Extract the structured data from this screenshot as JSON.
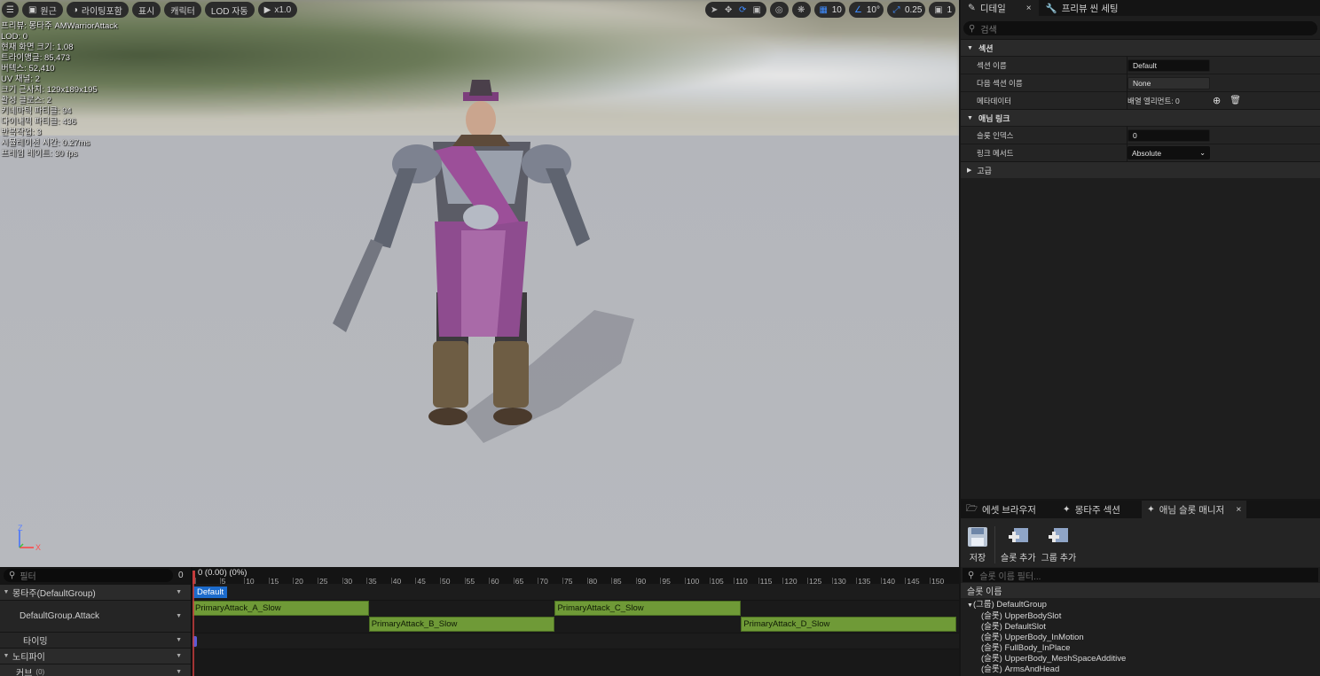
{
  "viewport": {
    "toolbar": {
      "menu_icon": "hamburger-icon",
      "perspective_label": "원근",
      "lighting_label": "라이팅포함",
      "show_label": "표시",
      "character_label": "캐릭터",
      "lod_label": "LOD 자동",
      "play_label": "x1.0",
      "grid_value": "10",
      "angle_value": "10°",
      "scale_value": "0.25",
      "camera_value": "1"
    },
    "stats": [
      "프리뷰: 몽타주 AMWarriorAttack",
      "LOD: 0",
      "현재 화면 크기: 1.08",
      "트라이앵글: 85,473",
      "버텍스: 52,410",
      "UV 채널: 2",
      "크기 근사치: 129x189x195",
      "활성 클로스: 2",
      "키네마틱 파티클: 94",
      "다이내믹 파티클: 436",
      "반복작업: 3",
      "시뮬레이션 시간: 0.27ms",
      "프레임 레이트: 30 fps"
    ],
    "axis": {
      "z": "Z",
      "x": "X"
    }
  },
  "details": {
    "tabs": [
      {
        "label": "디테일",
        "icon": "pencil-icon",
        "close": "×"
      },
      {
        "label": "프리뷰 씬 세팅",
        "icon": "wrench-icon"
      }
    ],
    "search_placeholder": "검색",
    "categories": {
      "section": "섹션",
      "anim_link": "애님 링크",
      "advanced": "고급"
    },
    "rows": {
      "section_name_label": "섹션 이름",
      "section_name_value": "Default",
      "next_section_label": "다음 섹션 이름",
      "next_section_value": "None",
      "metadata_label": "메타데이터",
      "metadata_value": "배열 엘리먼트: 0",
      "slot_index_label": "슬롯 인덱스",
      "slot_index_value": "0",
      "link_method_label": "링크 메서드",
      "link_method_value": "Absolute"
    }
  },
  "slot_manager": {
    "tabs": [
      {
        "label": "에셋 브라우저",
        "icon": "folder-icon"
      },
      {
        "label": "몽타주 섹션",
        "icon": "montage-icon"
      },
      {
        "label": "애님 슬롯 매니저",
        "icon": "slot-icon",
        "close": "×"
      }
    ],
    "toolbar": [
      {
        "label": "저장",
        "icon": "save-icon"
      },
      {
        "label": "슬롯 추가",
        "icon": "add-slot-icon"
      },
      {
        "label": "그룹 추가",
        "icon": "add-group-icon"
      }
    ],
    "search_placeholder": "슬롯 이름 필터...",
    "header": "슬롯 이름",
    "group": "(그룹) DefaultGroup",
    "slots": [
      "(슬롯) UpperBodySlot",
      "(슬롯) DefaultSlot",
      "(슬롯) UpperBody_InMotion",
      "(슬롯) FullBody_InPlace",
      "(슬롯) UpperBody_MeshSpaceAdditive",
      "(슬롯) ArmsAndHead"
    ]
  },
  "montage": {
    "filter_placeholder": "필터",
    "filter_count": "0",
    "tracks": {
      "montage_group": "몽타주(DefaultGroup)",
      "slot_track": "DefaultGroup.Attack",
      "timing": "타이밍",
      "notifies": "노티파이",
      "curves": "커브",
      "curves_count": "(0)"
    },
    "time_readout": "0 (0.00) (0%)",
    "ticks": [
      "0",
      "5",
      "10",
      "15",
      "20",
      "25",
      "30",
      "35",
      "40",
      "45",
      "50",
      "55",
      "60",
      "65",
      "70",
      "75",
      "80",
      "85",
      "90",
      "95",
      "100",
      "105",
      "110",
      "115",
      "120",
      "125",
      "130",
      "135",
      "140",
      "145",
      "150"
    ],
    "section_tag": "Default",
    "segments": [
      {
        "label": "PrimaryAttack_A_Slow",
        "row": 0,
        "start": 0,
        "end": 36
      },
      {
        "label": "PrimaryAttack_B_Slow",
        "row": 1,
        "start": 36,
        "end": 74
      },
      {
        "label": "PrimaryAttack_C_Slow",
        "row": 0,
        "start": 74,
        "end": 112
      },
      {
        "label": "PrimaryAttack_D_Slow",
        "row": 1,
        "start": 112,
        "end": 156
      }
    ],
    "colors": {
      "segment": "#6f9a37",
      "section": "#1c6bcc"
    }
  }
}
